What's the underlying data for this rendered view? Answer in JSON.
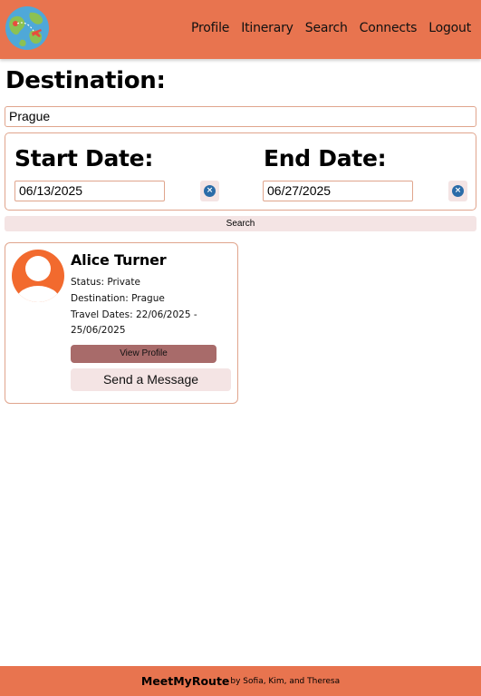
{
  "header": {
    "logo_icon": "globe-airplane-icon",
    "nav": [
      {
        "label": "Profile"
      },
      {
        "label": "Itinerary"
      },
      {
        "label": "Search"
      },
      {
        "label": "Connects"
      },
      {
        "label": "Logout"
      }
    ],
    "bg_color": "#e8744f"
  },
  "search": {
    "destination_label": "Destination:",
    "destination_value": "Prague",
    "start_label": "Start Date:",
    "start_value": "06/13/2025",
    "end_label": "End Date:",
    "end_value": "06/27/2025",
    "clear_icon": "clear-circle-icon",
    "search_label": "Search"
  },
  "results": [
    {
      "name": "Alice Turner",
      "status": "Status: Private",
      "destination": "Destination: Prague",
      "travel_dates_1": "Travel Dates: 22/06/2025 -",
      "travel_dates_2": "25/06/2025",
      "view_label": "View Profile",
      "message_label": "Send a Message",
      "avatar_icon": "user-avatar-icon"
    }
  ],
  "footer": {
    "brand": "MeetMyRoute",
    "credit": "by Sofia, Kim, and Theresa"
  }
}
